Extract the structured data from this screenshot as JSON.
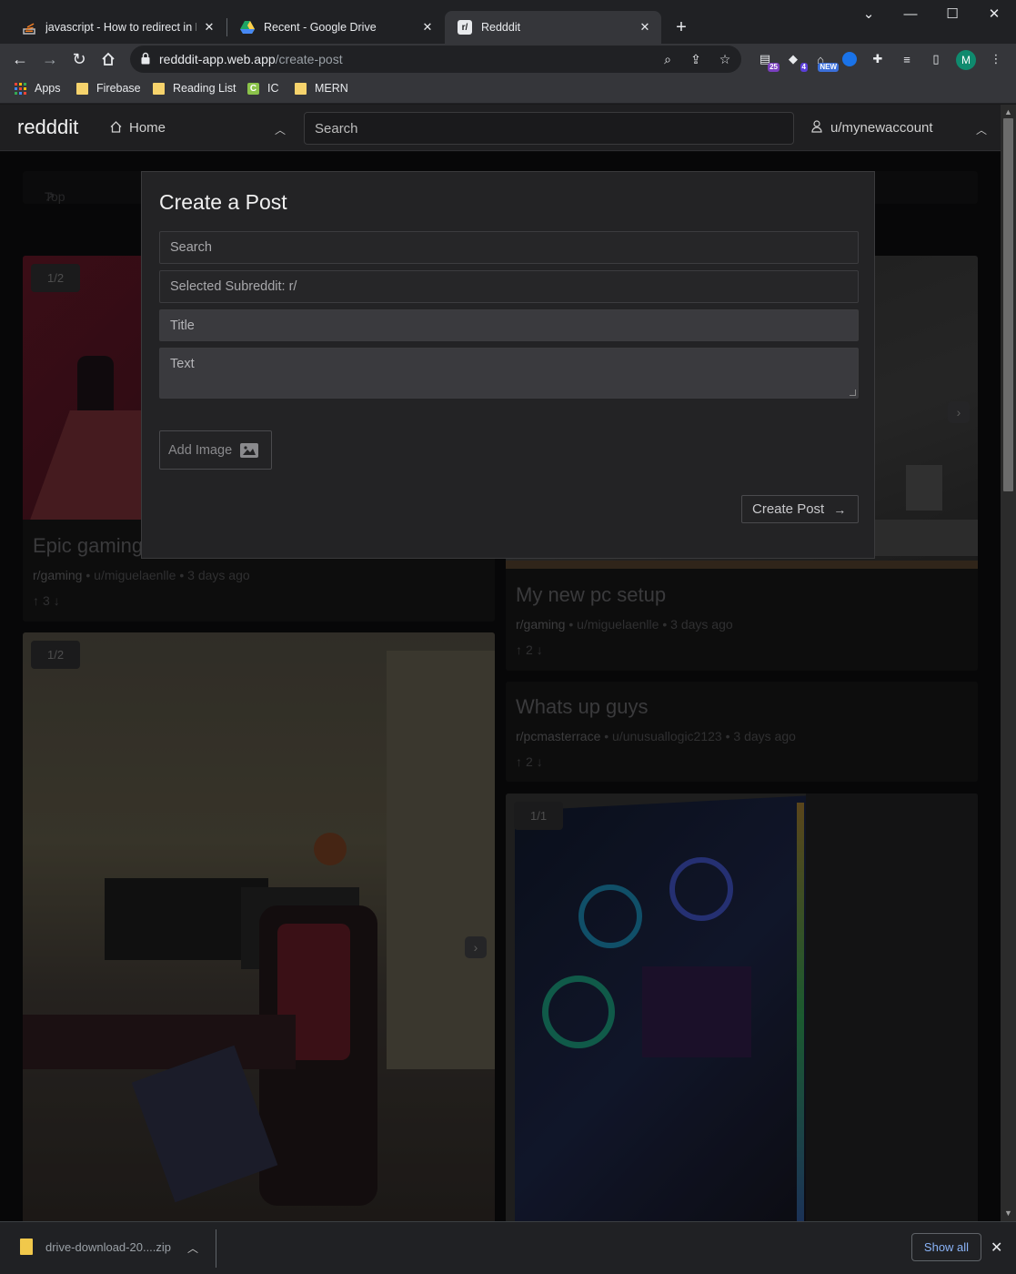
{
  "browser": {
    "tabs": [
      {
        "title": "javascript - How to redirect in Re",
        "favicon": "stackoverflow-icon"
      },
      {
        "title": "Recent - Google Drive",
        "favicon": "google-drive-icon"
      },
      {
        "title": "Redddit",
        "favicon": "redddit-icon",
        "favicon_text": "r/"
      }
    ],
    "url_host": "redddit-app.web.app",
    "url_path": "/create-post",
    "extension_badges": [
      "25",
      "4",
      "NEW"
    ],
    "avatar_letter": "M",
    "bookmarks": [
      "Apps",
      "Firebase",
      "Reading List",
      "IC",
      "MERN"
    ]
  },
  "navbar": {
    "brand": "redddit",
    "home_label": "Home",
    "search_placeholder": "Search",
    "user_label": "u/mynewaccount"
  },
  "feed": {
    "sort_label": "Top",
    "posts": [
      {
        "counter": "1/2",
        "title": "Epic gaming",
        "subreddit": "r/gaming",
        "author": "u/miguelaenlle",
        "age": "3 days ago",
        "votes": "3"
      },
      {
        "counter": "",
        "title": "My new pc setup",
        "subreddit": "r/gaming",
        "author": "u/miguelaenlle",
        "age": "3 days ago",
        "votes": "2"
      },
      {
        "counter": "",
        "title": "Whats up guys",
        "subreddit": "r/pcmasterrace",
        "author": "u/unusuallogic2123",
        "age": "3 days ago",
        "votes": "2"
      },
      {
        "counter": "1/2",
        "title": "",
        "subreddit": "",
        "author": "",
        "age": "",
        "votes": ""
      },
      {
        "counter": "1/1",
        "title": "",
        "subreddit": "",
        "author": "",
        "age": "",
        "votes": ""
      }
    ]
  },
  "modal": {
    "heading": "Create a Post",
    "search_placeholder": "Search",
    "selected_subreddit": "Selected Subreddit: r/",
    "title_placeholder": "Title",
    "text_placeholder": "Text",
    "add_image_label": "Add Image",
    "create_button_label": "Create Post"
  },
  "downloads": {
    "file_name": "drive-download-20....zip",
    "show_all_label": "Show all"
  }
}
